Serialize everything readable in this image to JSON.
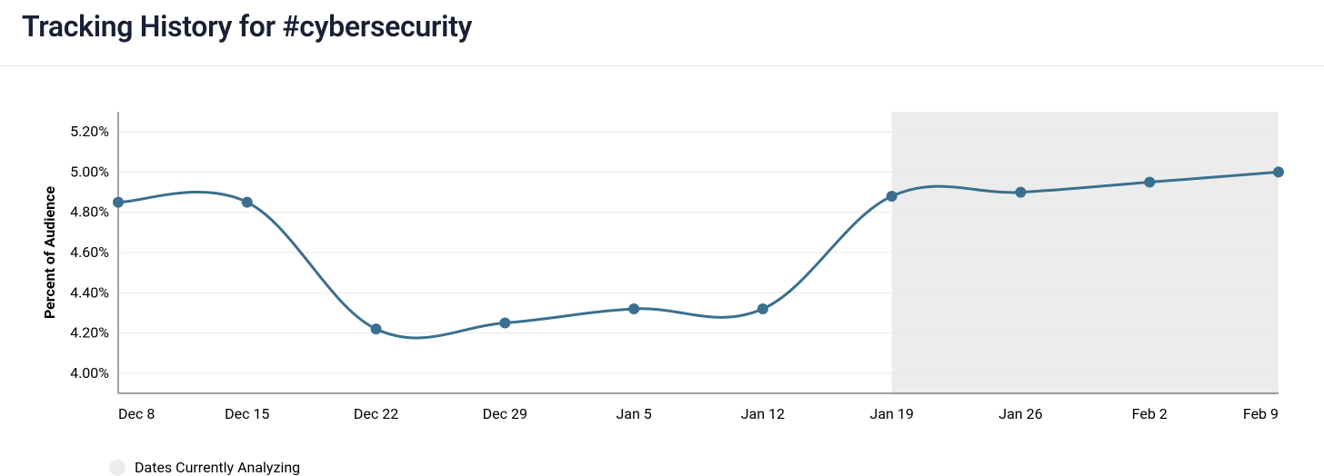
{
  "header": {
    "title": "Tracking History for #cybersecurity"
  },
  "legend": {
    "analyzing_label": "Dates Currently Analyzing"
  },
  "chart_data": {
    "type": "line",
    "title": "",
    "xlabel": "",
    "ylabel": "Percent of Audience",
    "ylim": [
      3.9,
      5.3
    ],
    "y_ticks": [
      4.0,
      4.2,
      4.4,
      4.6,
      4.8,
      5.0,
      5.2
    ],
    "y_tick_format": "percent_2dp",
    "categories": [
      "Dec 8",
      "Dec 15",
      "Dec 22",
      "Dec 29",
      "Jan 5",
      "Jan 12",
      "Jan 19",
      "Jan 26",
      "Feb 2",
      "Feb 9"
    ],
    "series": [
      {
        "name": "Percent of Audience",
        "values": [
          4.85,
          4.85,
          4.22,
          4.25,
          4.32,
          4.32,
          4.88,
          4.9,
          4.95,
          5.0
        ]
      }
    ],
    "highlight_range": {
      "from_category": "Jan 19",
      "to_category": "Feb 9",
      "label": "Dates Currently Analyzing"
    },
    "colors": {
      "line": "#3b6f8f",
      "highlight": "#ececec",
      "grid": "#e8e8e8"
    }
  }
}
